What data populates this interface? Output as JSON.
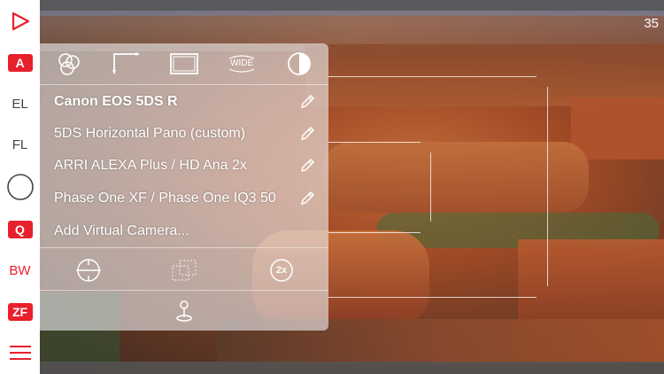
{
  "sidebar": {
    "badge_a": "A",
    "el": "EL",
    "fl": "FL",
    "badge_q": "Q",
    "bw": "BW",
    "badge_zf": "ZF"
  },
  "viewer": {
    "counter": "35"
  },
  "panel": {
    "tools": {
      "wide_label": "WIDE"
    },
    "cameras": [
      {
        "label": "Canon EOS 5DS R"
      },
      {
        "label": "5DS Horizontal Pano (custom)"
      },
      {
        "label": "ARRI ALEXA Plus / HD Ana 2x"
      },
      {
        "label": "Phase One XF / Phase One IQ3 50"
      }
    ],
    "add_camera": "Add Virtual Camera...",
    "bottom": {
      "anamorphic_label": "2x"
    }
  },
  "colors": {
    "accent": "#e8202c",
    "sidebar_bg": "#ffffff"
  },
  "icons": [
    "play-icon",
    "circle-icon",
    "menu-icon",
    "color-circles-icon",
    "frame-corner-icon",
    "aspect-frame-icon",
    "contrast-icon",
    "pencil-icon",
    "level-icon",
    "overlap-frames-icon",
    "pin-icon"
  ]
}
